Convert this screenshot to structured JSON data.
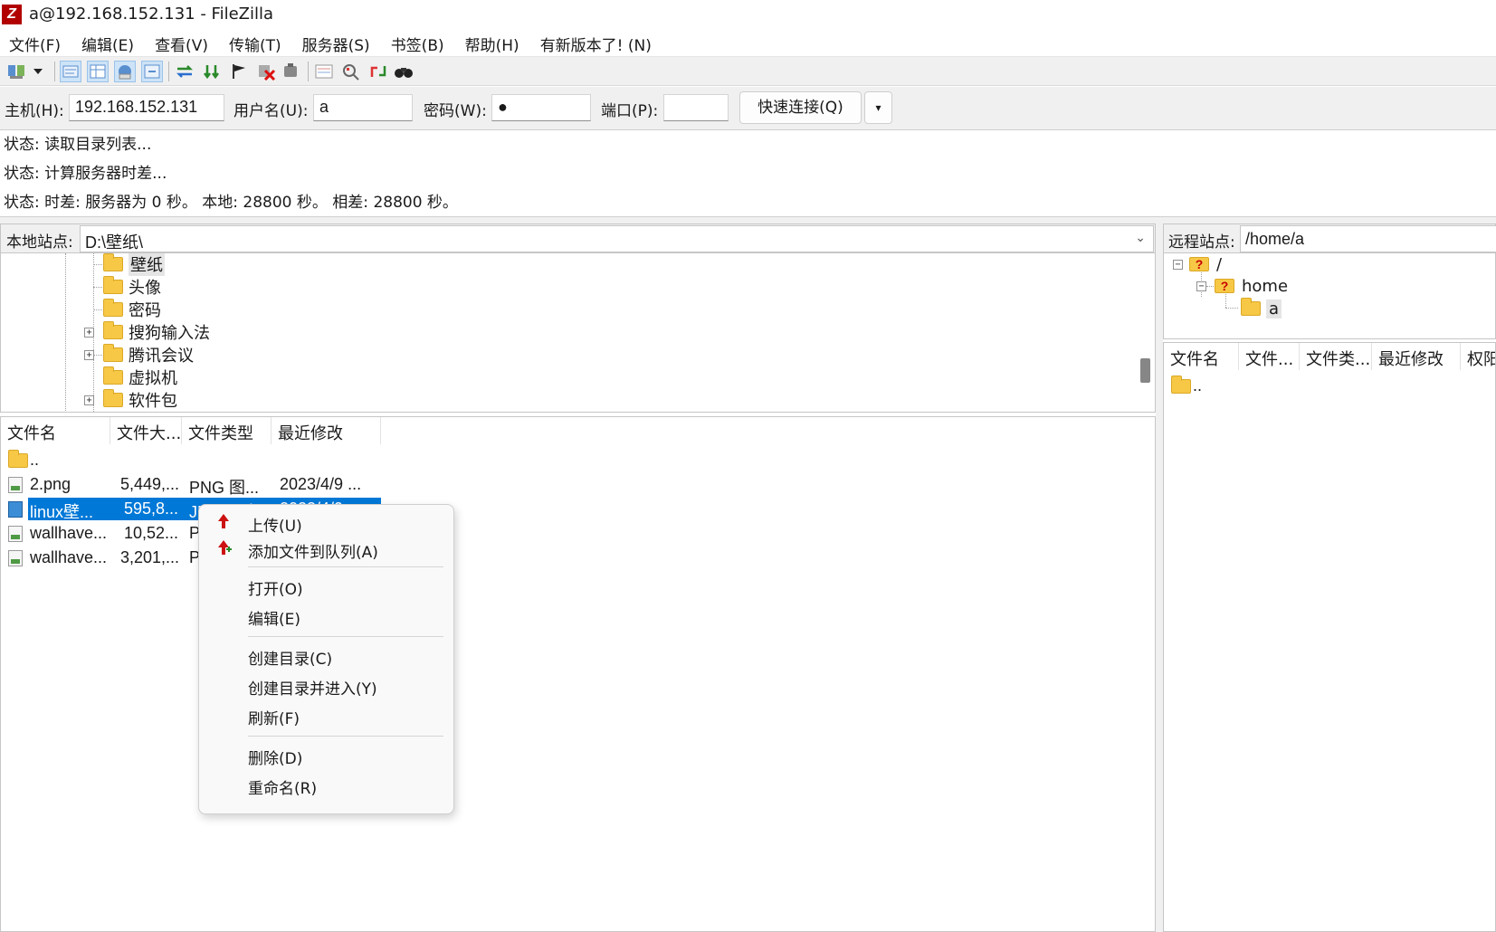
{
  "window": {
    "title": "a@192.168.152.131 - FileZilla",
    "app_icon": "Z"
  },
  "menu": [
    "文件(F)",
    "编辑(E)",
    "查看(V)",
    "传输(T)",
    "服务器(S)",
    "书签(B)",
    "帮助(H)",
    "有新版本了! (N)"
  ],
  "quickconnect": {
    "host_label": "主机(H):",
    "host_value": "192.168.152.131",
    "user_label": "用户名(U):",
    "user_value": "a",
    "pass_label": "密码(W):",
    "pass_value": "●",
    "port_label": "端口(P):",
    "port_value": "",
    "connect_label": "快速连接(Q)",
    "dropdown": "▾"
  },
  "log": [
    "状态: 读取目录列表...",
    "状态: 计算服务器时差...",
    "状态: 时差: 服务器为 0 秒。 本地: 28800 秒。 相差: 28800 秒。"
  ],
  "local": {
    "site_label": "本地站点:",
    "path": "D:\\壁纸\\",
    "tree": [
      {
        "name": "壁纸",
        "expandable": false,
        "selected": true
      },
      {
        "name": "头像",
        "expandable": false
      },
      {
        "name": "密码",
        "expandable": false
      },
      {
        "name": "搜狗输入法",
        "expandable": true
      },
      {
        "name": "腾讯会议",
        "expandable": true
      },
      {
        "name": "虚拟机",
        "expandable": false
      },
      {
        "name": "软件包",
        "expandable": true
      }
    ],
    "columns": [
      "文件名",
      "文件大...",
      "文件类型",
      "最近修改"
    ],
    "files": [
      {
        "name": "..",
        "size": "",
        "type": "",
        "modified": ""
      },
      {
        "name": "2.png",
        "size": "5,449,...",
        "type": "PNG 图...",
        "modified": "2023/4/9 ..."
      },
      {
        "name": "linux壁...",
        "size": "595,8...",
        "type": "JPG 图片",
        "modified": "2023/4/9 ...",
        "selected": true
      },
      {
        "name": "wallhave...",
        "size": "10,52...",
        "type": "P",
        "modified": ""
      },
      {
        "name": "wallhave...",
        "size": "3,201,...",
        "type": "P",
        "modified": ""
      }
    ]
  },
  "remote": {
    "site_label": "远程站点:",
    "path": "/home/a",
    "tree": [
      {
        "name": "/"
      },
      {
        "name": "home"
      },
      {
        "name": "a"
      }
    ],
    "columns": [
      "文件名",
      "文件...",
      "文件类...",
      "最近修改",
      "权阳"
    ],
    "files": [
      {
        "name": ".."
      }
    ]
  },
  "context_menu": {
    "items": [
      {
        "label": "上传(U)",
        "icon": "upload-arrow-icon"
      },
      {
        "label": "添加文件到队列(A)",
        "icon": "add-queue-icon"
      },
      {
        "label": "打开(O)"
      },
      {
        "label": "编辑(E)"
      },
      {
        "label": "创建目录(C)"
      },
      {
        "label": "创建目录并进入(Y)"
      },
      {
        "label": "刷新(F)"
      },
      {
        "label": "删除(D)"
      },
      {
        "label": "重命名(R)"
      }
    ]
  },
  "colors": {
    "selection": "#0078d7",
    "folder": "#f7c846",
    "app_icon": "#b20000",
    "upload_arrow": "#cc1111"
  }
}
